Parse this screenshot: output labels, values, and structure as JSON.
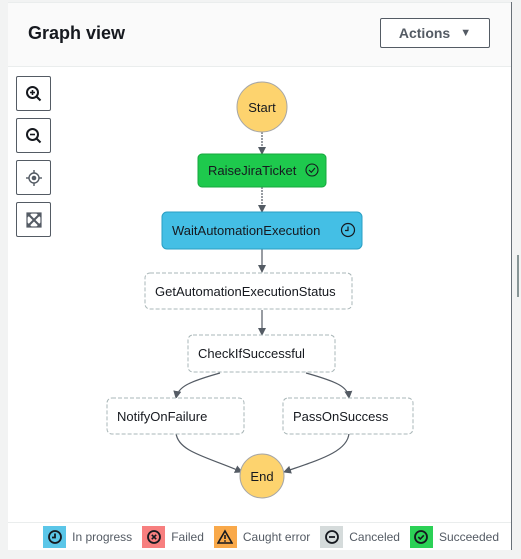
{
  "header": {
    "title": "Graph view",
    "actions_label": "Actions",
    "actions_caret": "▼"
  },
  "controls": [
    {
      "name": "zoom-in",
      "icon": "zoom-in-icon"
    },
    {
      "name": "zoom-out",
      "icon": "zoom-out-icon"
    },
    {
      "name": "center",
      "icon": "center-icon"
    },
    {
      "name": "fit",
      "icon": "expand-icon"
    }
  ],
  "colors": {
    "start_end": "#fdd36e",
    "succeeded": "#1ec94d",
    "in_progress": "#44bfe5",
    "failed": "#f77f7f",
    "caught_error": "#f9a94a",
    "canceled": "#d5dbdb",
    "not_started_border": "#aab7b8"
  },
  "graph": {
    "start": {
      "label": "Start"
    },
    "end": {
      "label": "End"
    },
    "states": [
      {
        "id": "raise",
        "label": "RaiseJiraTicket",
        "status": "succeeded",
        "icon": "check-circle-icon"
      },
      {
        "id": "wait",
        "label": "WaitAutomationExecution",
        "status": "in_progress",
        "icon": "clock-icon"
      },
      {
        "id": "get",
        "label": "GetAutomationExecutionStatus",
        "status": "not_started"
      },
      {
        "id": "check",
        "label": "CheckIfSuccessful",
        "status": "not_started"
      },
      {
        "id": "notify",
        "label": "NotifyOnFailure",
        "status": "not_started"
      },
      {
        "id": "pass",
        "label": "PassOnSuccess",
        "status": "not_started"
      }
    ],
    "edges": [
      [
        "start",
        "raise"
      ],
      [
        "raise",
        "wait"
      ],
      [
        "wait",
        "get"
      ],
      [
        "get",
        "check"
      ],
      [
        "check",
        "notify"
      ],
      [
        "check",
        "pass"
      ],
      [
        "notify",
        "end"
      ],
      [
        "pass",
        "end"
      ]
    ]
  },
  "legend": [
    {
      "label": "In progress",
      "icon": "clock-icon",
      "color": "#5bc6e8"
    },
    {
      "label": "Failed",
      "icon": "x-circle-icon",
      "color": "#f77f7f"
    },
    {
      "label": "Caught error",
      "icon": "warning-icon",
      "color": "#f9a94a"
    },
    {
      "label": "Canceled",
      "icon": "minus-circle-icon",
      "color": "#d5dbdb"
    },
    {
      "label": "Succeeded",
      "icon": "check-circle-icon",
      "color": "#2bd156"
    }
  ]
}
